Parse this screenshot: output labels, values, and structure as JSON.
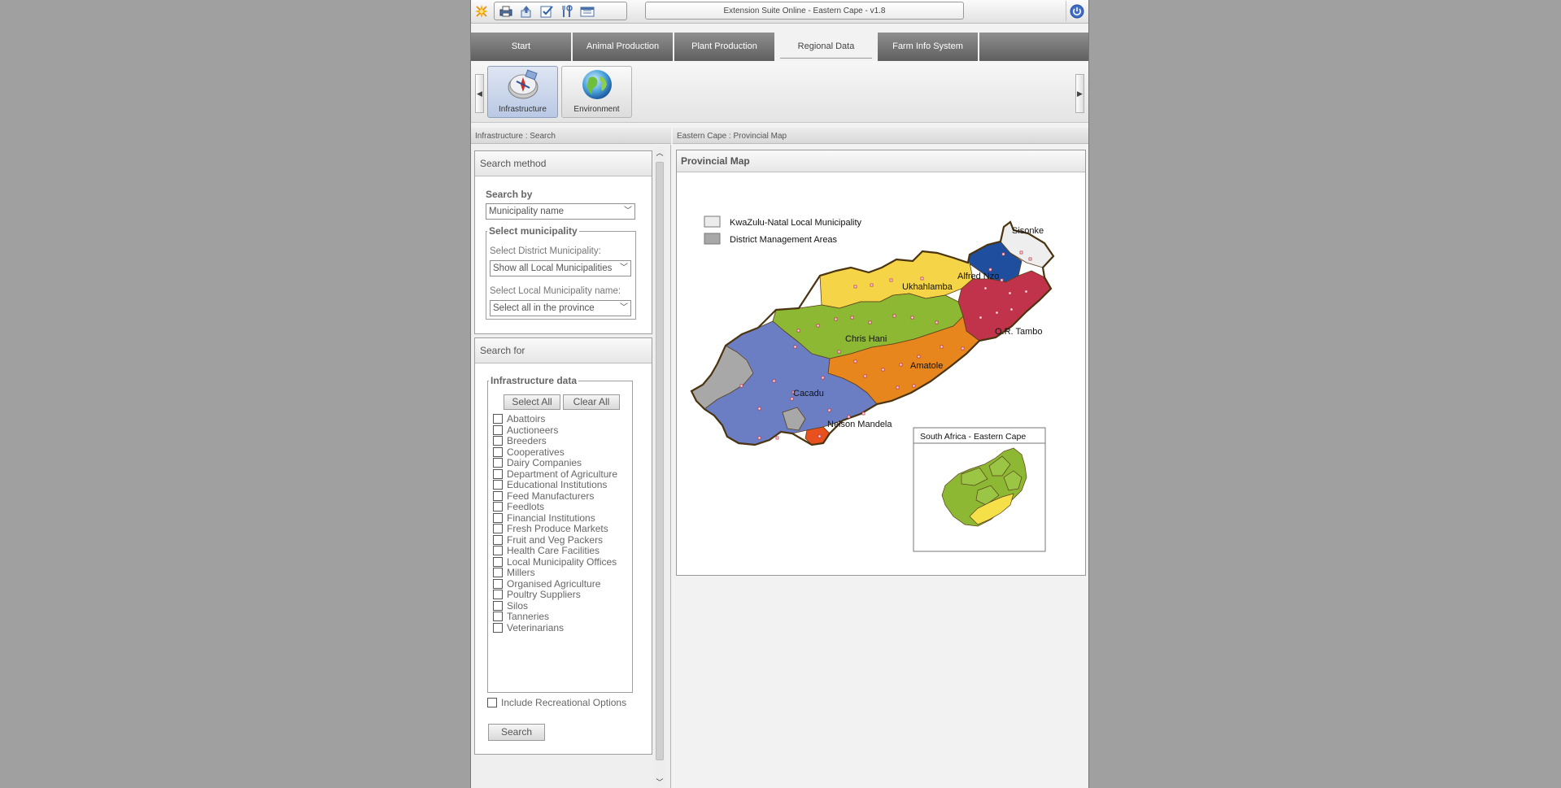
{
  "app": {
    "title": "Extension Suite Online - Eastern Cape - v1.8",
    "toolbar_icons": [
      "print-icon",
      "export-icon",
      "checklist-icon",
      "tools-icon",
      "report-icon"
    ]
  },
  "tabs": [
    {
      "label": "Start",
      "active": false
    },
    {
      "label": "Animal Production",
      "active": false
    },
    {
      "label": "Plant Production",
      "active": false
    },
    {
      "label": "Regional Data",
      "active": true
    },
    {
      "label": "Farm Info System",
      "active": false
    }
  ],
  "ribbon": {
    "buttons": [
      {
        "label": "Infrastructure",
        "icon": "compass-icon",
        "selected": true
      },
      {
        "label": "Environment",
        "icon": "globe-icon",
        "selected": false
      }
    ]
  },
  "left_panel": {
    "breadcrumb": "Infrastructure : Search",
    "search_method": {
      "title": "Search method",
      "search_by_label": "Search by",
      "search_by_value": "Municipality name",
      "select_municipality_legend": "Select municipality",
      "district_label": "Select District Municipality:",
      "district_value": "Show all Local Municipalities",
      "local_label": "Select Local Municipality name:",
      "local_value": "Select all in the province"
    },
    "search_for": {
      "title": "Search for",
      "infra_legend": "Infrastructure data",
      "select_all": "Select All",
      "clear_all": "Clear All",
      "items": [
        "Abattoirs",
        "Auctioneers",
        "Breeders",
        "Cooperatives",
        "Dairy Companies",
        "Department of Agriculture",
        "Educational Institutions",
        "Feed Manufacturers",
        "Feedlots",
        "Financial Institutions",
        "Fresh Produce Markets",
        "Fruit and Veg Packers",
        "Health Care Facilities",
        "Local Municipality Offices",
        "Millers",
        "Organised Agriculture",
        "Poultry Suppliers",
        "Silos",
        "Tanneries",
        "Veterinarians"
      ],
      "recreational": "Include Recreational Options",
      "search_button": "Search"
    }
  },
  "right_panel": {
    "breadcrumb": "Eastern Cape : Provincial Map",
    "map_title": "Provincial Map",
    "legend": [
      {
        "label": "KwaZulu-Natal Local Municipality",
        "color": "#ececec"
      },
      {
        "label": "District Management Areas",
        "color": "#a8a8a8"
      }
    ],
    "regions": [
      {
        "name": "Sisonke",
        "color": "#eeeeee"
      },
      {
        "name": "Alfred Nzo",
        "color": "#1f4e9e"
      },
      {
        "name": "Ukhahlamba",
        "color": "#f5d447"
      },
      {
        "name": "O.R. Tambo",
        "color": "#c0334a"
      },
      {
        "name": "Chris Hani",
        "color": "#8db833"
      },
      {
        "name": "Amatole",
        "color": "#e8861e"
      },
      {
        "name": "Cacadu",
        "color": "#6b7ec4"
      },
      {
        "name": "Nelson Mandela",
        "color": "#e8501e"
      }
    ],
    "inset_title": "South Africa - Eastern Cape"
  }
}
